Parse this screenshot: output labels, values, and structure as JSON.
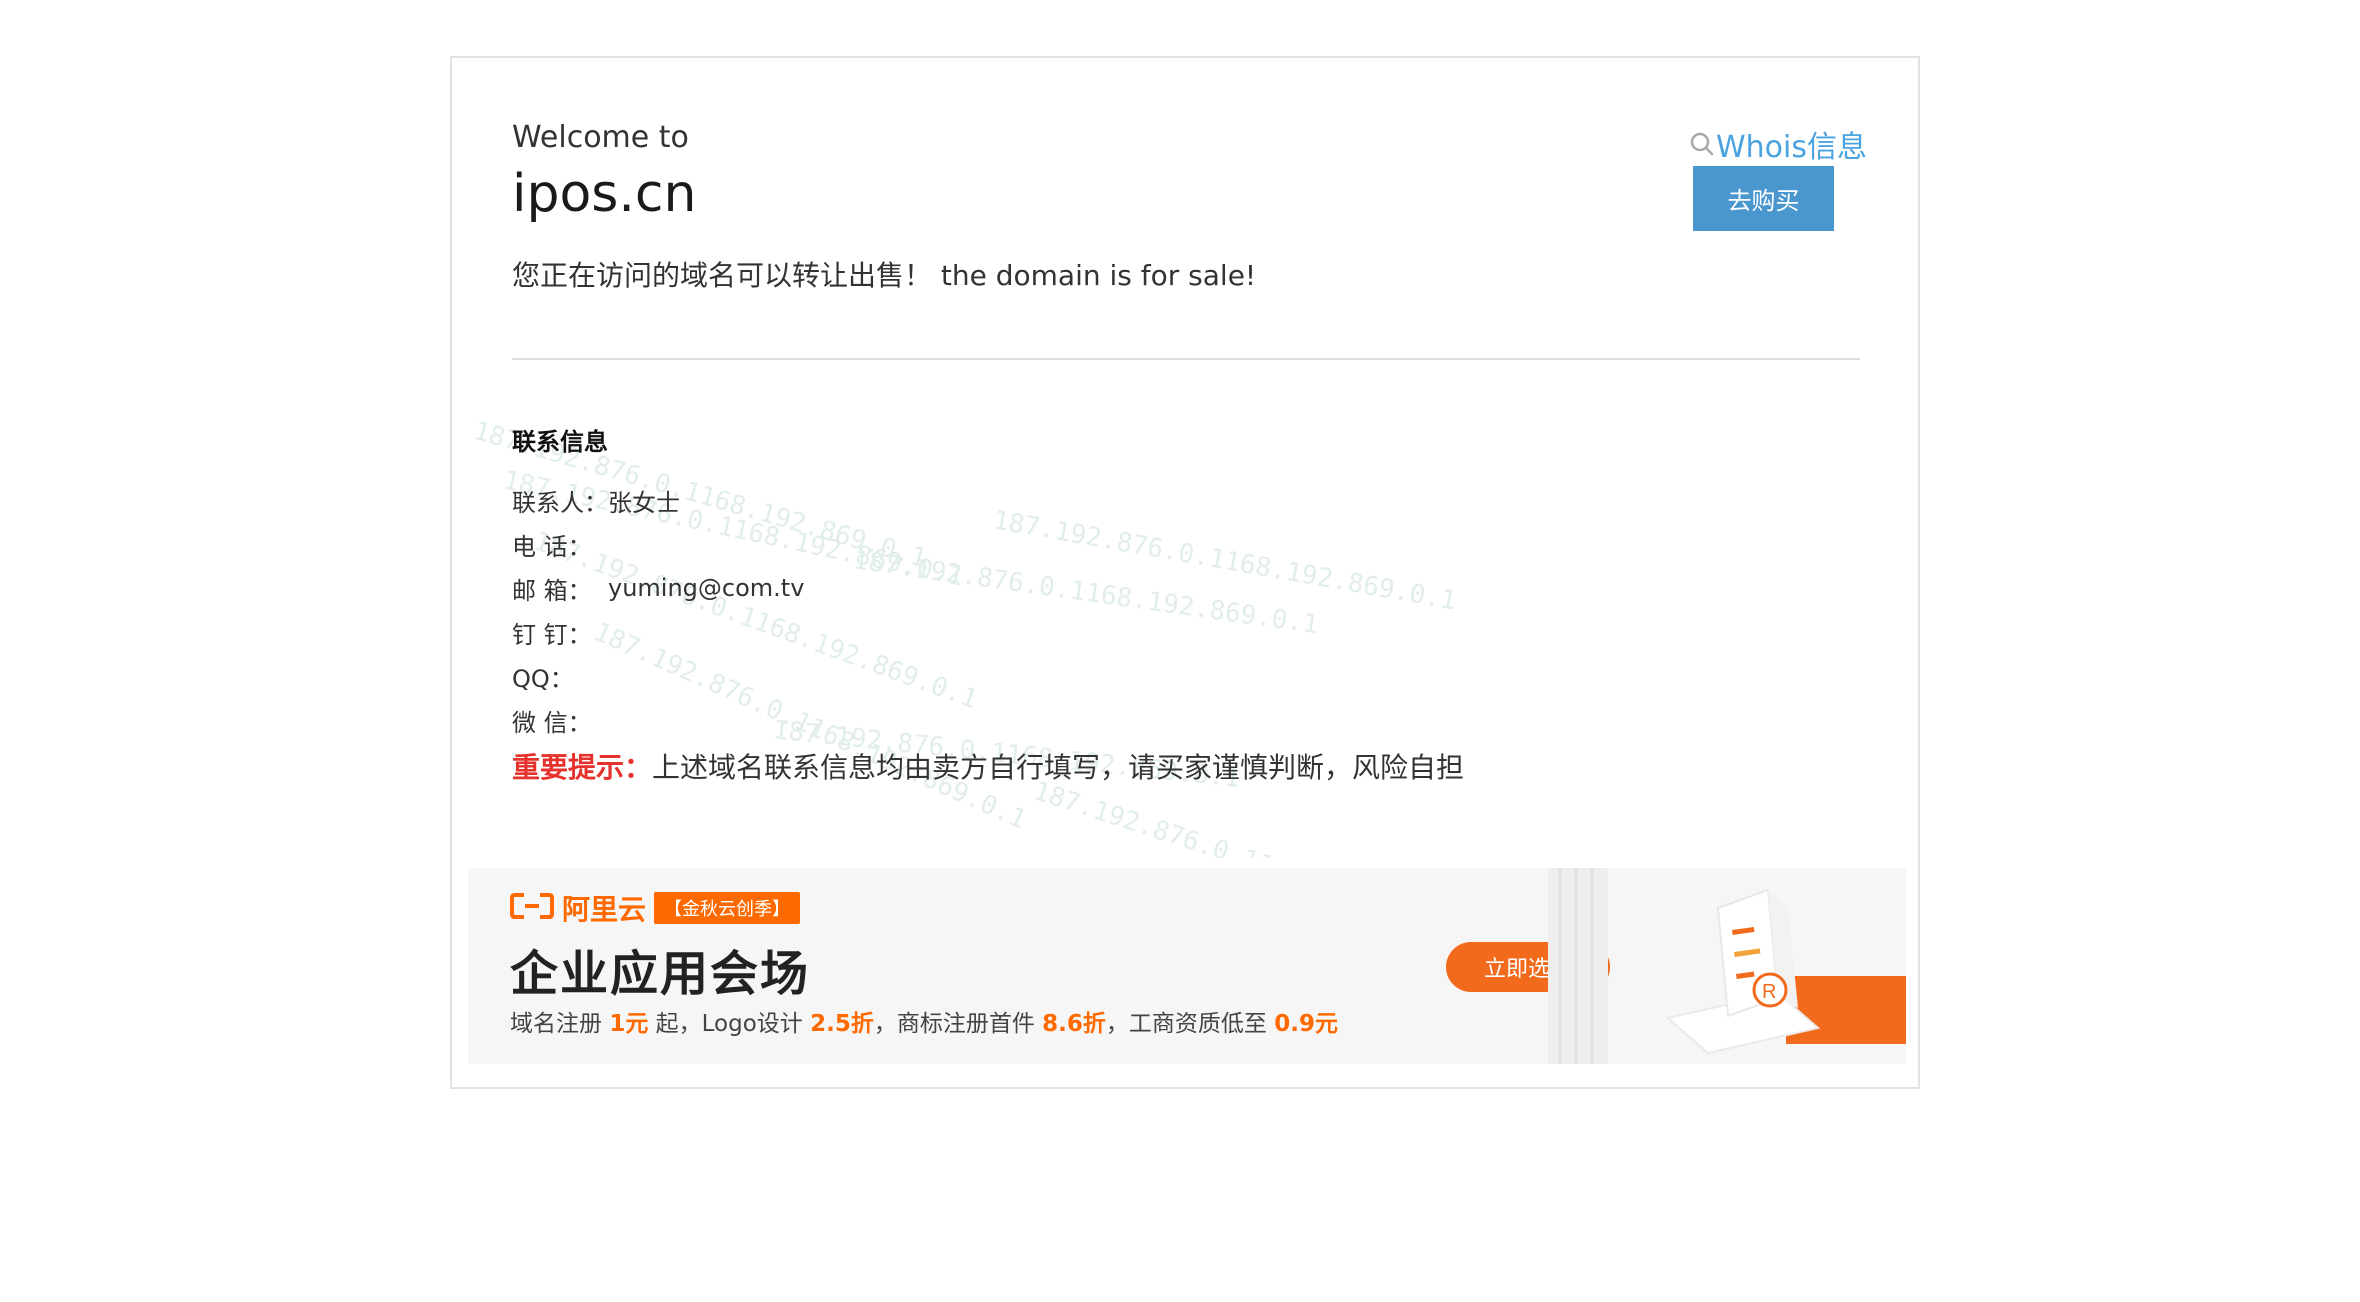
{
  "header": {
    "welcome": "Welcome to",
    "domain": "ipos.cn",
    "sale_text": "您正在访问的域名可以转让出售！ the domain is for sale!",
    "whois_label": "Whois信息",
    "buy_label": "去购买"
  },
  "contact": {
    "title": "联系信息",
    "rows": [
      {
        "label": "联系人：",
        "value": "张女士"
      },
      {
        "label": "电 话：",
        "value": ""
      },
      {
        "label": "邮 箱：",
        "value": "yuming@com.tv"
      },
      {
        "label": "钉 钉：",
        "value": ""
      },
      {
        "label": "QQ：",
        "value": ""
      },
      {
        "label": "微 信：",
        "value": ""
      }
    ]
  },
  "notice": {
    "highlight": "重要提示：",
    "text": "上述域名联系信息均由卖方自行填写，请买家谨慎判断，风险自担"
  },
  "banner": {
    "brand": "阿里云",
    "tag": "【金秋云创季】",
    "title": "企业应用会场",
    "desc_parts": [
      "域名注册 ",
      "1元",
      " 起，Logo设计 ",
      "2.5折",
      "，商标注册首件 ",
      "8.6折",
      "，工商资质低至 ",
      "0.9元"
    ],
    "button": "立即选购"
  },
  "watermark_text": "187.192.876.0.1168.192.869.0.1",
  "colors": {
    "accent_blue": "#4a96cf",
    "link_blue": "#4aa3df",
    "warning_red": "#e5322d",
    "aliyun_orange": "#ff6a00"
  }
}
